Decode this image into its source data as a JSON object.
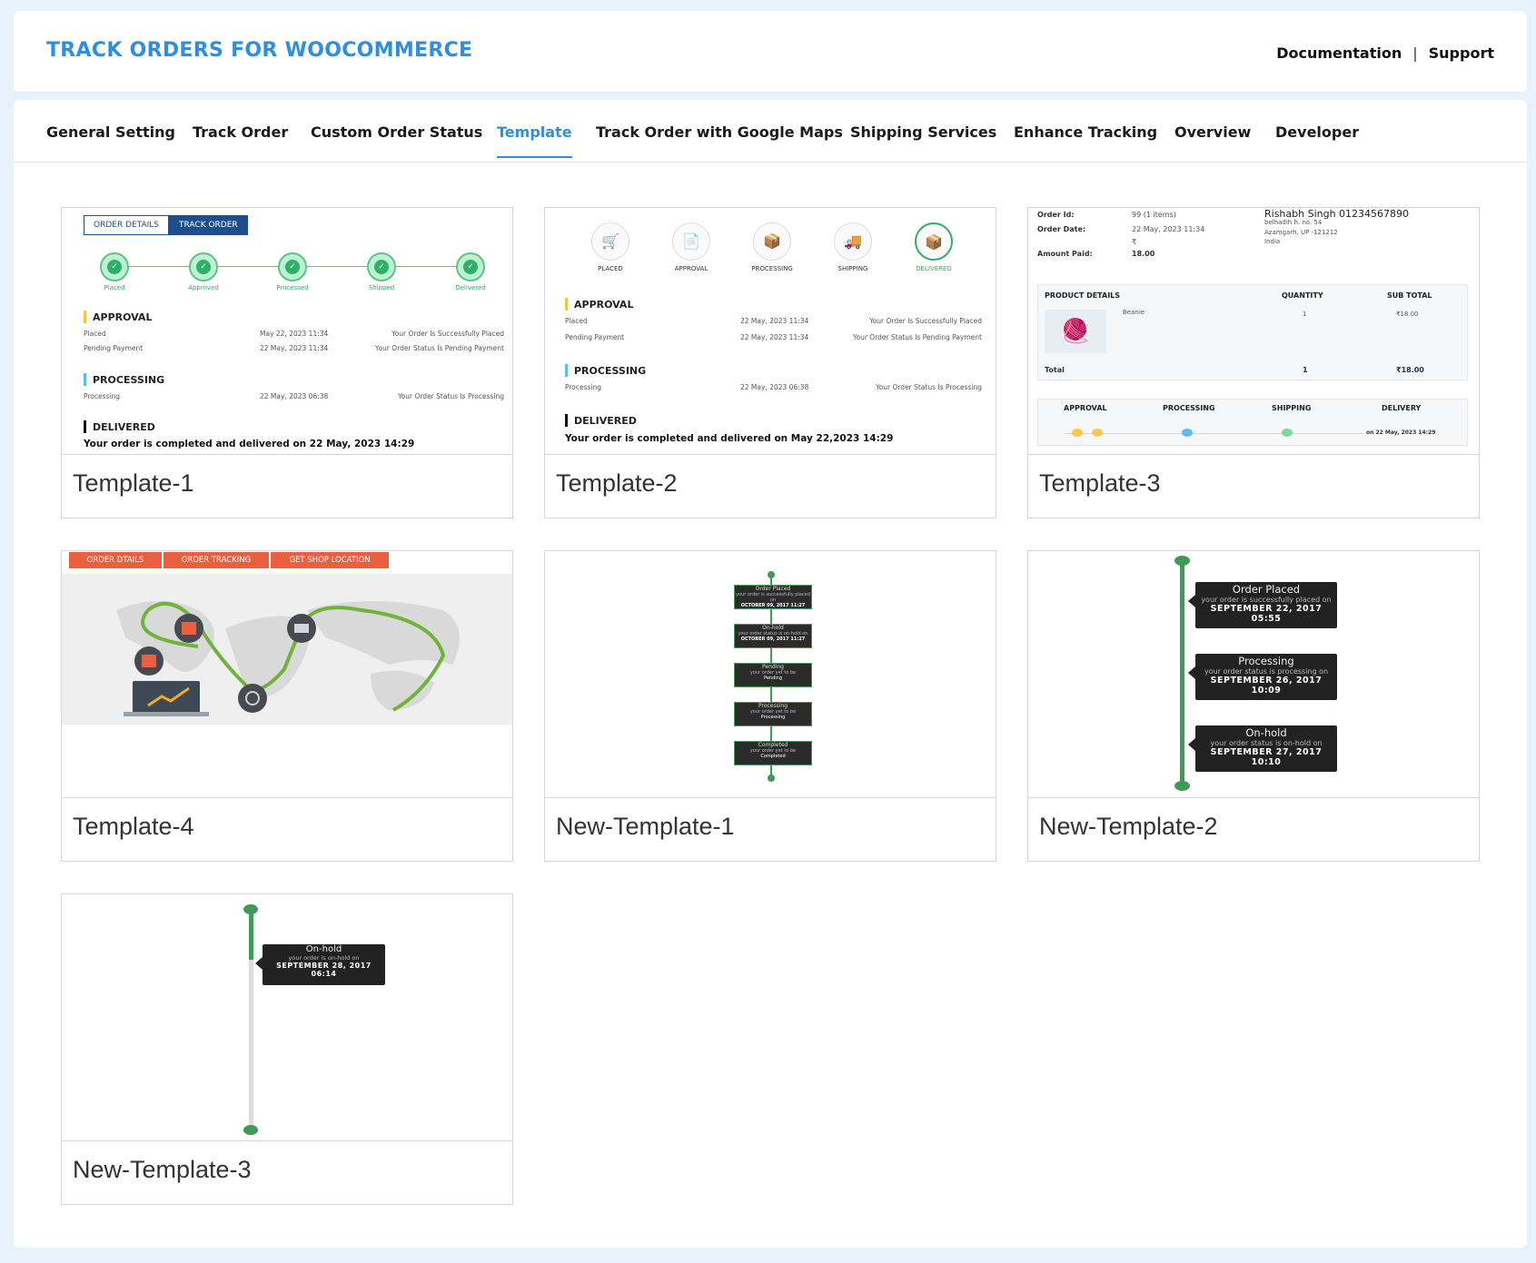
{
  "header": {
    "title": "TRACK ORDERS FOR WOOCOMMERCE",
    "links": {
      "documentation": "Documentation",
      "separator": "|",
      "support": "Support"
    }
  },
  "tabs": [
    {
      "label": "General Setting"
    },
    {
      "label": "Track Order"
    },
    {
      "label": "Custom Order Status"
    },
    {
      "label": "Template",
      "active": true
    },
    {
      "label": "Track Order with Google Maps"
    },
    {
      "label": "Shipping Services"
    },
    {
      "label": "Enhance Tracking"
    },
    {
      "label": "Overview"
    },
    {
      "label": "Developer"
    }
  ],
  "colors": {
    "accent": "#2d8fe3",
    "green": "#2fb06a",
    "timeline_green": "#3f9a55",
    "orange": "#e8603f"
  },
  "templates": [
    {
      "label": "Template-1",
      "tabs": [
        "ORDER DETAILS",
        "TRACK ORDER"
      ],
      "steps": [
        "Placed",
        "Approved",
        "Processed",
        "Shipped",
        "Delivered"
      ],
      "sections": {
        "approval": "APPROVAL",
        "processing": "PROCESSING",
        "delivered": "DELIVERED"
      },
      "rows": [
        {
          "name": "Placed",
          "date": "May 22, 2023 11:34",
          "msg": "Your Order Is Successfully Placed"
        },
        {
          "name": "Pending Payment",
          "date": "22 May, 2023 11:34",
          "msg": "Your Order Status Is Pending Payment"
        },
        {
          "name": "Processing",
          "date": "22 May, 2023 06:38",
          "msg": "Your Order Status Is Processing"
        }
      ],
      "delivered_text": "Your order is completed and delivered on 22 May, 2023 14:29"
    },
    {
      "label": "Template-2",
      "steps": [
        "PLACED",
        "APPROVAL",
        "PROCESSING",
        "SHIPPING",
        "DELIVERED"
      ],
      "sections": {
        "approval": "APPROVAL",
        "processing": "PROCESSING",
        "delivered": "DELIVERED"
      },
      "rows": [
        {
          "name": "Placed",
          "date": "22 May, 2023 11:34",
          "msg": "Your Order Is Successfully Placed"
        },
        {
          "name": "Pending Payment",
          "date": "22 May, 2023 11:34",
          "msg": "Your Order Status Is Pending Payment"
        },
        {
          "name": "Processing",
          "date": "22 May, 2023 06:38",
          "msg": "Your Order Status Is Processing"
        }
      ],
      "delivered_text": "Your order is completed and delivered on May 22,2023 14:29"
    },
    {
      "label": "Template-3",
      "order_id_label": "Order Id:",
      "order_id": "99 (1 items)",
      "order_date_label": "Order Date:",
      "order_date": "22 May, 2023 11:34",
      "currency": "₹",
      "amount_label": "Amount Paid:",
      "amount": "18.00",
      "customer_name": "Rishabh Singh 01234567890",
      "address": [
        "belhadih h. no. 54",
        "Azamgarh, UP -121212",
        "India"
      ],
      "table_headers": [
        "PRODUCT DETAILS",
        "QUANTITY",
        "SUB TOTAL"
      ],
      "product": {
        "name": "Beanie",
        "qty": "1",
        "subtotal": "₹18.00"
      },
      "total": {
        "label": "Total",
        "qty": "1",
        "subtotal": "₹18.00"
      },
      "status_headers": [
        "APPROVAL",
        "PROCESSING",
        "SHIPPING",
        "DELIVERY"
      ],
      "delivery_date": "on 22 May, 2023 14:29"
    },
    {
      "label": "Template-4",
      "buttons": [
        "ORDER DTAILS",
        "ORDER TRACKING",
        "GET SHOP LOCATION"
      ]
    },
    {
      "label": "New-Template-1",
      "items": [
        {
          "title": "Order Placed",
          "desc": "your order is successfully placed on",
          "date": "OCTOBER 09, 2017 11:27"
        },
        {
          "title": "On-hold",
          "desc": "your order status is on-hold on",
          "date": "OCTOBER 09, 2017 11:27"
        },
        {
          "title": "Pending",
          "desc": "your order yet to be",
          "date": "Pending"
        },
        {
          "title": "Processing",
          "desc": "your order yet to be",
          "date": "Processing"
        },
        {
          "title": "Completed",
          "desc": "your order yet to be",
          "date": "Completed"
        }
      ]
    },
    {
      "label": "New-Template-2",
      "items": [
        {
          "title": "Order Placed",
          "desc": "your order is successfully placed on",
          "date": "SEPTEMBER 22, 2017",
          "time": "05:55"
        },
        {
          "title": "Processing",
          "desc": "your order status is processing on",
          "date": "SEPTEMBER 26, 2017",
          "time": "10:09"
        },
        {
          "title": "On-hold",
          "desc": "your order status is on-hold on",
          "date": "SEPTEMBER 27, 2017",
          "time": "10:10"
        }
      ]
    },
    {
      "label": "New-Template-3",
      "items": [
        {
          "title": "On-hold",
          "desc": "your order is on-hold on",
          "date": "SEPTEMBER 28, 2017",
          "time": "06:14"
        }
      ]
    }
  ]
}
